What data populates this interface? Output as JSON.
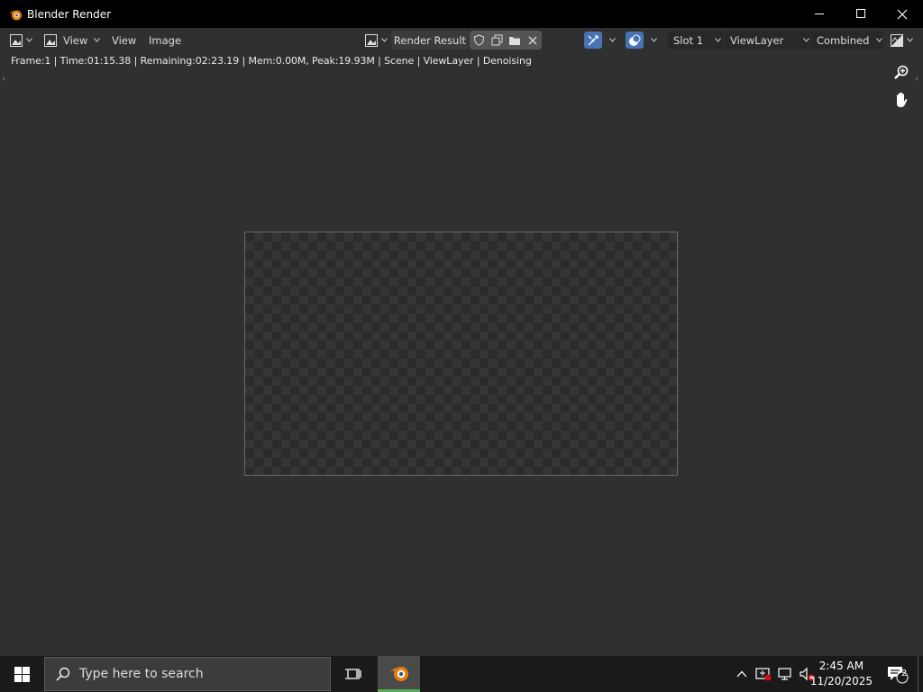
{
  "window": {
    "title": "Blender Render"
  },
  "header": {
    "view_menu": "View",
    "image_menu": "Image",
    "view_dropdown": "View",
    "image_name": "Render Result",
    "slot": "Slot 1",
    "view_layer": "ViewLayer",
    "pass": "Combined"
  },
  "status_text": "Frame:1 | Time:01:15.38 | Remaining:02:23.19 | Mem:0.00M, Peak:19.93M | Scene | ViewLayer | Denoising",
  "taskbar": {
    "search_placeholder": "Type here to search",
    "time": "2:45 AM",
    "date": "11/20/2025",
    "notification_count": "2"
  },
  "colors": {
    "background": "#303030",
    "accent_blue": "#4772b3",
    "blender_orange": "#e87d0d",
    "titlebar": "#000000"
  },
  "icons": [
    "blender-logo-icon",
    "minimize-icon",
    "maximize-icon",
    "close-icon",
    "editor-type-icon",
    "image-icon",
    "shield-icon",
    "duplicate-icon",
    "folder-icon",
    "x-icon",
    "gizmo-icon",
    "overlay-icon",
    "display-channels-icon",
    "zoom-icon",
    "hand-icon",
    "windows-start-icon",
    "search-icon",
    "task-view-icon",
    "chevron-up-icon",
    "security-icon",
    "network-icon",
    "volume-muted-icon",
    "notification-icon"
  ]
}
